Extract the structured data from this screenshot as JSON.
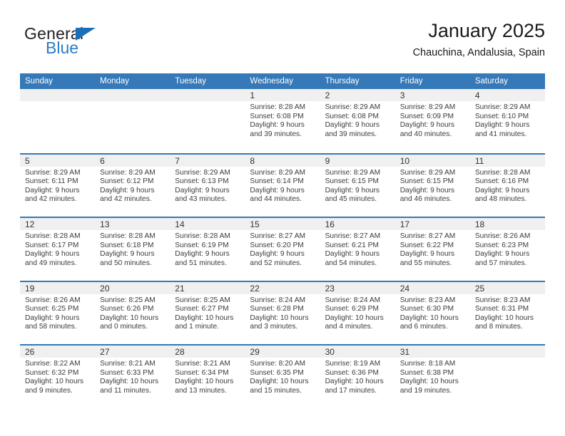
{
  "brand": {
    "name_part1": "General",
    "name_part2": "Blue",
    "logo_icon": "triangle-logo-icon",
    "accent_color": "#1b6fb8"
  },
  "header": {
    "title": "January 2025",
    "location": "Chauchina, Andalusia, Spain"
  },
  "theme": {
    "header_blue": "#3579b8",
    "day_band_gray": "#f0f0f0",
    "text_dark": "#333333"
  },
  "weekdays": [
    "Sunday",
    "Monday",
    "Tuesday",
    "Wednesday",
    "Thursday",
    "Friday",
    "Saturday"
  ],
  "weeks": [
    [
      {
        "day": "",
        "empty": true
      },
      {
        "day": "",
        "empty": true
      },
      {
        "day": "",
        "empty": true
      },
      {
        "day": "1",
        "sunrise": "Sunrise: 8:28 AM",
        "sunset": "Sunset: 6:08 PM",
        "daylight1": "Daylight: 9 hours",
        "daylight2": "and 39 minutes."
      },
      {
        "day": "2",
        "sunrise": "Sunrise: 8:29 AM",
        "sunset": "Sunset: 6:08 PM",
        "daylight1": "Daylight: 9 hours",
        "daylight2": "and 39 minutes."
      },
      {
        "day": "3",
        "sunrise": "Sunrise: 8:29 AM",
        "sunset": "Sunset: 6:09 PM",
        "daylight1": "Daylight: 9 hours",
        "daylight2": "and 40 minutes."
      },
      {
        "day": "4",
        "sunrise": "Sunrise: 8:29 AM",
        "sunset": "Sunset: 6:10 PM",
        "daylight1": "Daylight: 9 hours",
        "daylight2": "and 41 minutes."
      }
    ],
    [
      {
        "day": "5",
        "sunrise": "Sunrise: 8:29 AM",
        "sunset": "Sunset: 6:11 PM",
        "daylight1": "Daylight: 9 hours",
        "daylight2": "and 42 minutes."
      },
      {
        "day": "6",
        "sunrise": "Sunrise: 8:29 AM",
        "sunset": "Sunset: 6:12 PM",
        "daylight1": "Daylight: 9 hours",
        "daylight2": "and 42 minutes."
      },
      {
        "day": "7",
        "sunrise": "Sunrise: 8:29 AM",
        "sunset": "Sunset: 6:13 PM",
        "daylight1": "Daylight: 9 hours",
        "daylight2": "and 43 minutes."
      },
      {
        "day": "8",
        "sunrise": "Sunrise: 8:29 AM",
        "sunset": "Sunset: 6:14 PM",
        "daylight1": "Daylight: 9 hours",
        "daylight2": "and 44 minutes."
      },
      {
        "day": "9",
        "sunrise": "Sunrise: 8:29 AM",
        "sunset": "Sunset: 6:15 PM",
        "daylight1": "Daylight: 9 hours",
        "daylight2": "and 45 minutes."
      },
      {
        "day": "10",
        "sunrise": "Sunrise: 8:29 AM",
        "sunset": "Sunset: 6:15 PM",
        "daylight1": "Daylight: 9 hours",
        "daylight2": "and 46 minutes."
      },
      {
        "day": "11",
        "sunrise": "Sunrise: 8:28 AM",
        "sunset": "Sunset: 6:16 PM",
        "daylight1": "Daylight: 9 hours",
        "daylight2": "and 48 minutes."
      }
    ],
    [
      {
        "day": "12",
        "sunrise": "Sunrise: 8:28 AM",
        "sunset": "Sunset: 6:17 PM",
        "daylight1": "Daylight: 9 hours",
        "daylight2": "and 49 minutes."
      },
      {
        "day": "13",
        "sunrise": "Sunrise: 8:28 AM",
        "sunset": "Sunset: 6:18 PM",
        "daylight1": "Daylight: 9 hours",
        "daylight2": "and 50 minutes."
      },
      {
        "day": "14",
        "sunrise": "Sunrise: 8:28 AM",
        "sunset": "Sunset: 6:19 PM",
        "daylight1": "Daylight: 9 hours",
        "daylight2": "and 51 minutes."
      },
      {
        "day": "15",
        "sunrise": "Sunrise: 8:27 AM",
        "sunset": "Sunset: 6:20 PM",
        "daylight1": "Daylight: 9 hours",
        "daylight2": "and 52 minutes."
      },
      {
        "day": "16",
        "sunrise": "Sunrise: 8:27 AM",
        "sunset": "Sunset: 6:21 PM",
        "daylight1": "Daylight: 9 hours",
        "daylight2": "and 54 minutes."
      },
      {
        "day": "17",
        "sunrise": "Sunrise: 8:27 AM",
        "sunset": "Sunset: 6:22 PM",
        "daylight1": "Daylight: 9 hours",
        "daylight2": "and 55 minutes."
      },
      {
        "day": "18",
        "sunrise": "Sunrise: 8:26 AM",
        "sunset": "Sunset: 6:23 PM",
        "daylight1": "Daylight: 9 hours",
        "daylight2": "and 57 minutes."
      }
    ],
    [
      {
        "day": "19",
        "sunrise": "Sunrise: 8:26 AM",
        "sunset": "Sunset: 6:25 PM",
        "daylight1": "Daylight: 9 hours",
        "daylight2": "and 58 minutes."
      },
      {
        "day": "20",
        "sunrise": "Sunrise: 8:25 AM",
        "sunset": "Sunset: 6:26 PM",
        "daylight1": "Daylight: 10 hours",
        "daylight2": "and 0 minutes."
      },
      {
        "day": "21",
        "sunrise": "Sunrise: 8:25 AM",
        "sunset": "Sunset: 6:27 PM",
        "daylight1": "Daylight: 10 hours",
        "daylight2": "and 1 minute."
      },
      {
        "day": "22",
        "sunrise": "Sunrise: 8:24 AM",
        "sunset": "Sunset: 6:28 PM",
        "daylight1": "Daylight: 10 hours",
        "daylight2": "and 3 minutes."
      },
      {
        "day": "23",
        "sunrise": "Sunrise: 8:24 AM",
        "sunset": "Sunset: 6:29 PM",
        "daylight1": "Daylight: 10 hours",
        "daylight2": "and 4 minutes."
      },
      {
        "day": "24",
        "sunrise": "Sunrise: 8:23 AM",
        "sunset": "Sunset: 6:30 PM",
        "daylight1": "Daylight: 10 hours",
        "daylight2": "and 6 minutes."
      },
      {
        "day": "25",
        "sunrise": "Sunrise: 8:23 AM",
        "sunset": "Sunset: 6:31 PM",
        "daylight1": "Daylight: 10 hours",
        "daylight2": "and 8 minutes."
      }
    ],
    [
      {
        "day": "26",
        "sunrise": "Sunrise: 8:22 AM",
        "sunset": "Sunset: 6:32 PM",
        "daylight1": "Daylight: 10 hours",
        "daylight2": "and 9 minutes."
      },
      {
        "day": "27",
        "sunrise": "Sunrise: 8:21 AM",
        "sunset": "Sunset: 6:33 PM",
        "daylight1": "Daylight: 10 hours",
        "daylight2": "and 11 minutes."
      },
      {
        "day": "28",
        "sunrise": "Sunrise: 8:21 AM",
        "sunset": "Sunset: 6:34 PM",
        "daylight1": "Daylight: 10 hours",
        "daylight2": "and 13 minutes."
      },
      {
        "day": "29",
        "sunrise": "Sunrise: 8:20 AM",
        "sunset": "Sunset: 6:35 PM",
        "daylight1": "Daylight: 10 hours",
        "daylight2": "and 15 minutes."
      },
      {
        "day": "30",
        "sunrise": "Sunrise: 8:19 AM",
        "sunset": "Sunset: 6:36 PM",
        "daylight1": "Daylight: 10 hours",
        "daylight2": "and 17 minutes."
      },
      {
        "day": "31",
        "sunrise": "Sunrise: 8:18 AM",
        "sunset": "Sunset: 6:38 PM",
        "daylight1": "Daylight: 10 hours",
        "daylight2": "and 19 minutes."
      },
      {
        "day": "",
        "empty": true
      }
    ]
  ]
}
